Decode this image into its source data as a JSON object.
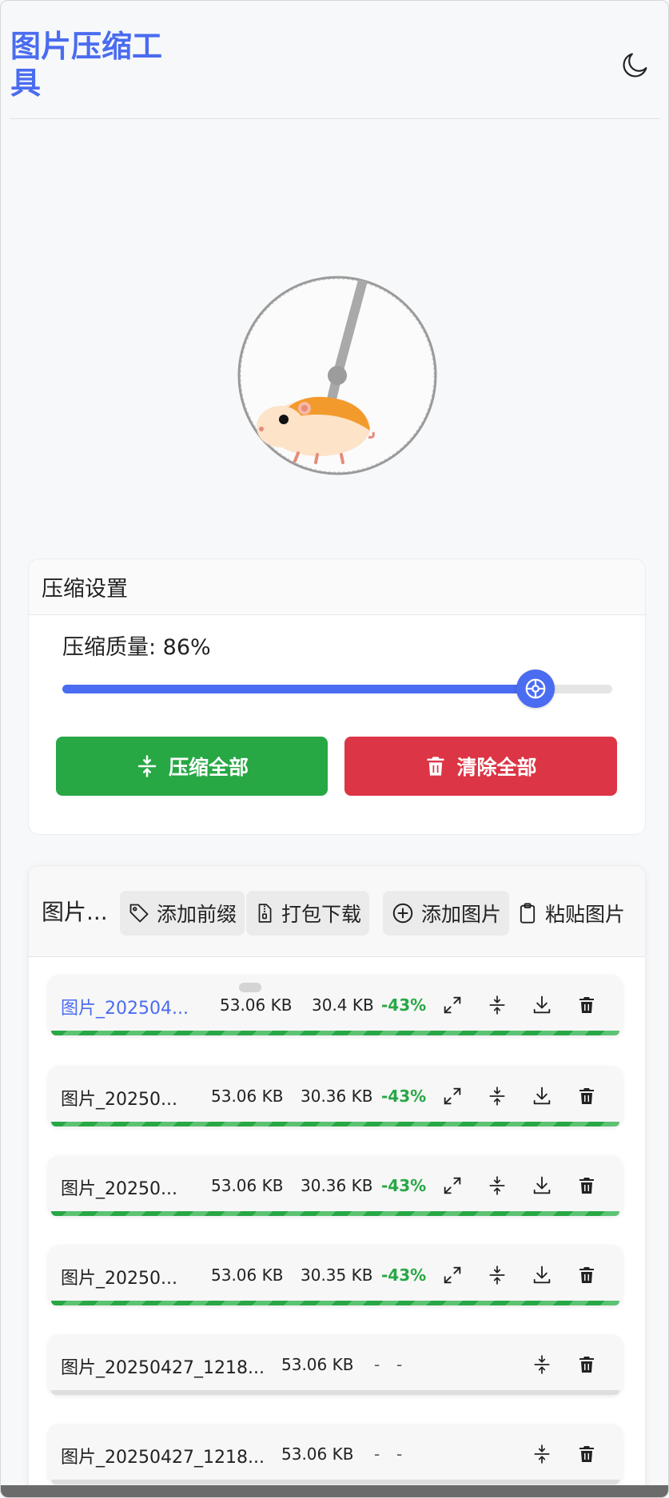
{
  "header": {
    "title": "图片压缩工具",
    "theme_icon": "moon-icon"
  },
  "settings": {
    "heading": "压缩设置",
    "quality_label": "压缩质量: 86%",
    "quality_value": 86,
    "compress_all_label": "压缩全部",
    "clear_all_label": "清除全部"
  },
  "images": {
    "title": "图片...",
    "add_prefix_label": "添加前缀",
    "pack_download_label": "打包下载",
    "add_image_label": "添加图片",
    "paste_image_label": "粘贴图片",
    "rows": [
      {
        "name": "图片_202504...",
        "original": "53.06 KB",
        "compressed": "30.4 KB",
        "reduction": "-43%",
        "done": true
      },
      {
        "name": "图片_20250...",
        "original": "53.06 KB",
        "compressed": "30.36 KB",
        "reduction": "-43%",
        "done": true
      },
      {
        "name": "图片_20250...",
        "original": "53.06 KB",
        "compressed": "30.36 KB",
        "reduction": "-43%",
        "done": true
      },
      {
        "name": "图片_20250...",
        "original": "53.06 KB",
        "compressed": "30.35 KB",
        "reduction": "-43%",
        "done": true
      },
      {
        "name": "图片_20250427_1218...",
        "original": "53.06 KB",
        "compressed": "-",
        "reduction": "-",
        "done": false
      },
      {
        "name": "图片_20250427_1218...",
        "original": "53.06 KB",
        "compressed": "-",
        "reduction": "-",
        "done": false
      }
    ]
  },
  "colors": {
    "accent": "#4a6cf0",
    "success": "#28a745",
    "danger": "#dc3545"
  }
}
